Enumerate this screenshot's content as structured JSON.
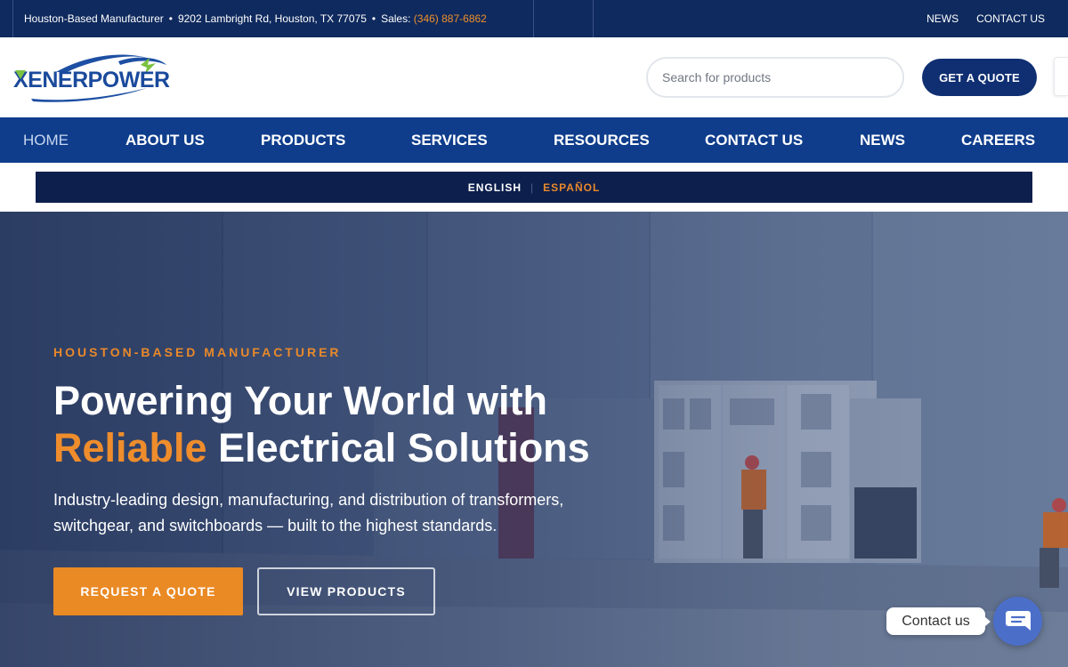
{
  "topbar": {
    "tagline": "Houston-Based Manufacturer",
    "address": "9202 Lambright Rd, Houston, TX 77075",
    "sales_label": "Sales:",
    "phone": "(346) 887-6862",
    "links": [
      "NEWS",
      "CONTACT US"
    ]
  },
  "header": {
    "logo_text": "XENERPOWER",
    "search_placeholder": "Search for products",
    "quote_button": "GET A QUOTE"
  },
  "nav": {
    "items": [
      "HOME",
      "ABOUT US",
      "PRODUCTS",
      "SERVICES",
      "RESOURCES",
      "CONTACT US",
      "NEWS",
      "CAREERS"
    ],
    "active": "HOME"
  },
  "language": {
    "english": "ENGLISH",
    "separator": "|",
    "spanish": "ESPAÑOL"
  },
  "hero": {
    "eyebrow": "HOUSTON-BASED MANUFACTURER",
    "headline_line1": "Powering Your World with",
    "headline_accent": "Reliable",
    "headline_rest": " Electrical Solutions",
    "subtext": "Industry-leading design, manufacturing, and distribution of transformers, switchgear, and switchboards — built to the highest standards.",
    "primary_button": "REQUEST A QUOTE",
    "secondary_button": "VIEW PRODUCTS"
  },
  "contact_widget": {
    "label": "Contact us",
    "icon": "chat-icon"
  },
  "colors": {
    "navy": "#0f2a5e",
    "nav_blue": "#0f3d8c",
    "accent_orange": "#e8892a"
  }
}
